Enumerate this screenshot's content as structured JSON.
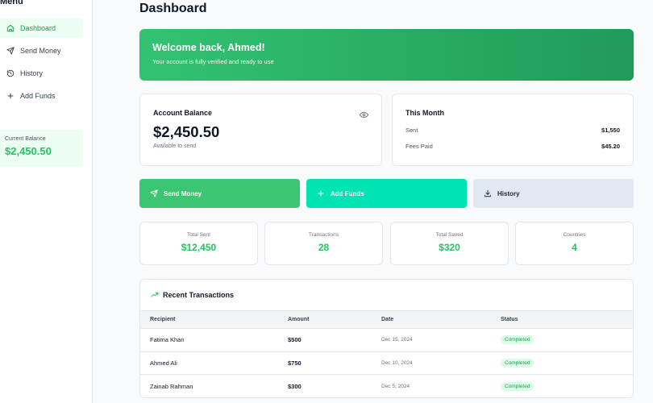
{
  "sidebar": {
    "menu_title": "Menu",
    "items": [
      {
        "label": "Dashboard",
        "icon": "home-icon",
        "active": true
      },
      {
        "label": "Send Money",
        "icon": "send-icon"
      },
      {
        "label": "History",
        "icon": "history-icon"
      },
      {
        "label": "Add Funds",
        "icon": "plus-icon"
      }
    ],
    "balance_label": "Current Balance",
    "balance_value": "$2,450.50"
  },
  "page": {
    "title": "Dashboard"
  },
  "welcome": {
    "title": "Welcome back, Ahmed!",
    "subtitle": "Your account is fully verified and ready to use"
  },
  "balance_card": {
    "label": "Account Balance",
    "value": "$2,450.50",
    "sub": "Available to send",
    "icon": "eye-icon"
  },
  "month_card": {
    "title": "This Month",
    "rows": [
      {
        "label": "Sent",
        "value": "$1,550"
      },
      {
        "label": "Fees Paid",
        "value": "$45.20"
      }
    ]
  },
  "actions": {
    "send": "Send Money",
    "add": "Add Funds",
    "history": "History"
  },
  "stats": [
    {
      "label": "Total Sent",
      "value": "$12,450"
    },
    {
      "label": "Transactions",
      "value": "28"
    },
    {
      "label": "Total Saved",
      "value": "$320"
    },
    {
      "label": "Countries",
      "value": "4"
    }
  ],
  "transactions": {
    "title": "Recent Transactions",
    "columns": [
      "Recipient",
      "Amount",
      "Date",
      "Status"
    ],
    "rows": [
      {
        "recipient": "Fatima Khan",
        "amount": "$500",
        "date": "Dec 15, 2024",
        "status": "Completed"
      },
      {
        "recipient": "Ahmed Ali",
        "amount": "$750",
        "date": "Dec 10, 2024",
        "status": "Completed"
      },
      {
        "recipient": "Zainab Rahman",
        "amount": "$300",
        "date": "Dec 5, 2024",
        "status": "Completed"
      }
    ]
  },
  "colors": {
    "accent": "#22c55e",
    "welcome_start": "#33c272",
    "welcome_end": "#1f9b58",
    "add_funds": "#00e4b4",
    "history_btn": "#e2e8f0"
  }
}
